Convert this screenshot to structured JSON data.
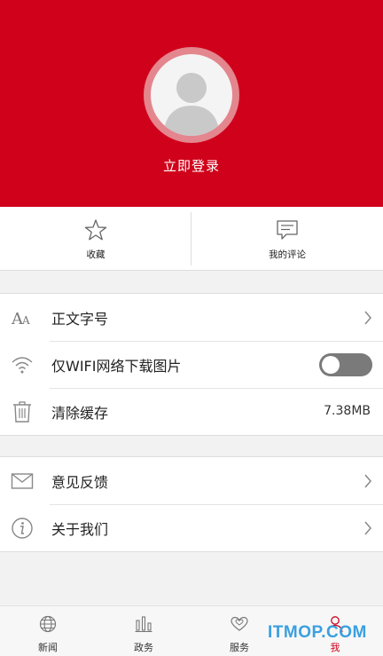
{
  "header": {
    "login_label": "立即登录"
  },
  "quick_actions": [
    {
      "label": "收藏",
      "icon": "star-icon"
    },
    {
      "label": "我的评论",
      "icon": "comment-icon"
    }
  ],
  "settings": {
    "font_size_label": "正文字号",
    "wifi_only_label": "仅WIFI网络下载图片",
    "wifi_only_enabled": false,
    "clear_cache_label": "清除缓存",
    "cache_size": "7.38MB"
  },
  "more": {
    "feedback_label": "意见反馈",
    "about_label": "关于我们"
  },
  "tabbar": {
    "items": [
      {
        "label": "新闻",
        "icon": "globe-icon"
      },
      {
        "label": "政务",
        "icon": "bar-chart-icon"
      },
      {
        "label": "服务",
        "icon": "hearts-icon"
      },
      {
        "label": "我",
        "icon": "person-icon",
        "active": true
      }
    ]
  },
  "watermark": "ITMOP.COM",
  "colors": {
    "brand_red": "#d0021b",
    "toggle_off": "#7a7a7a"
  }
}
